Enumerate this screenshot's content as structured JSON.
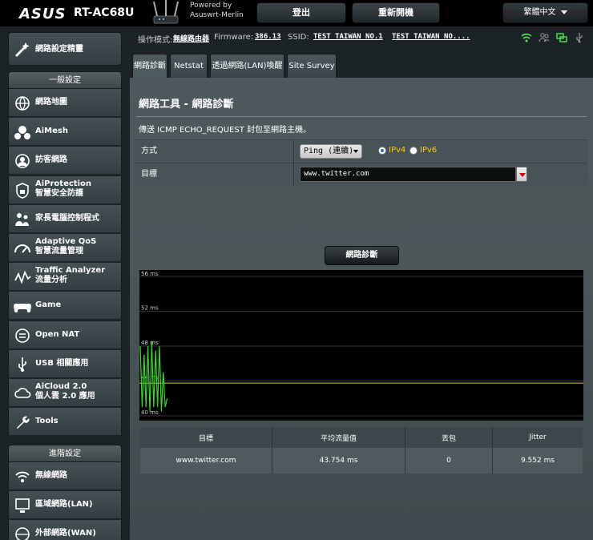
{
  "header": {
    "brand": "ASUS",
    "model": "RT-AC68U",
    "powered_line1": "Powered by",
    "powered_line2": "Asuswrt-Merlin",
    "logout_label": "登出",
    "reboot_label": "重新開機",
    "language": "繁體中文"
  },
  "status": {
    "mode_label": "操作模式:",
    "mode_value": "無線路由器",
    "firmware_label": "Firmware:",
    "firmware_value": "386.13",
    "ssid_label": "SSID:",
    "ssid1": "TEST_TAIWAN_NO.1",
    "ssid2": "TEST_TAIWAN_NO...."
  },
  "sidebar": {
    "qis_label": "網路設定精靈",
    "general_header": "一般設定",
    "general_items": [
      {
        "line1": "網路地圖",
        "line2": "",
        "icon": "network-map-icon"
      },
      {
        "line1": "AiMesh",
        "line2": "",
        "icon": "aimesh-icon"
      },
      {
        "line1": "訪客網路",
        "line2": "",
        "icon": "guest-network-icon"
      },
      {
        "line1": "AiProtection",
        "line2": "智慧安全防護",
        "icon": "aiprotection-icon"
      },
      {
        "line1": "家長電腦控制程式",
        "line2": "",
        "icon": "parental-control-icon"
      },
      {
        "line1": "Adaptive QoS",
        "line2": "智慧流量管理",
        "icon": "qos-gauge-icon"
      },
      {
        "line1": "Traffic Analyzer",
        "line2": "流量分析",
        "icon": "traffic-analyzer-icon"
      },
      {
        "line1": "Game",
        "line2": "",
        "icon": "gamepad-icon"
      },
      {
        "line1": "Open NAT",
        "line2": "",
        "icon": "open-nat-icon"
      },
      {
        "line1": "USB 相關應用",
        "line2": "",
        "icon": "usb-icon"
      },
      {
        "line1": "AiCloud 2.0",
        "line2": "個人雲 2.0 應用",
        "icon": "aicloud-icon"
      },
      {
        "line1": "Tools",
        "line2": "",
        "icon": "wrench-icon"
      }
    ],
    "advanced_header": "進階設定",
    "advanced_items": [
      {
        "line1": "無線網路",
        "line2": "",
        "icon": "wireless-icon"
      },
      {
        "line1": "區域網路(LAN)",
        "line2": "",
        "icon": "lan-icon"
      },
      {
        "line1": "外部網路(WAN)",
        "line2": "",
        "icon": "wan-icon"
      }
    ]
  },
  "tabs": [
    "網路診斷",
    "Netstat",
    "透過網路(LAN)喚醒",
    "Site Survey"
  ],
  "page": {
    "title": "網路工具 - 網路診斷",
    "description": "傳送 ICMP ECHO_REQUEST 封包至網路主機。",
    "method_label": "方式",
    "method_value": "Ping (連續)",
    "ipv4_label": "IPv4",
    "ipv6_label": "IPv6",
    "ip_selected": "IPv4",
    "target_label": "目標",
    "target_value": "www.twitter.com",
    "diagnose_button": "網路診斷"
  },
  "chart_data": {
    "type": "line",
    "y_ticks": [
      "56 ms",
      "52 ms",
      "48 ms",
      "44 ms",
      "40 ms"
    ],
    "ylim": [
      40,
      56
    ],
    "average_ms": 43.754,
    "series": [
      {
        "color": "#33dd22",
        "values": [
          48,
          41,
          47,
          41,
          48,
          40.5,
          48.5,
          41,
          47.5,
          41,
          48,
          40.5,
          45,
          41,
          42
        ]
      }
    ],
    "average_line_color": "#c8a832",
    "grid": true
  },
  "results": {
    "headers": [
      "目標",
      "平均流量值",
      "丟包",
      "Jitter"
    ],
    "row": [
      "www.twitter.com",
      "43.754 ms",
      "0",
      "9.552 ms"
    ]
  }
}
